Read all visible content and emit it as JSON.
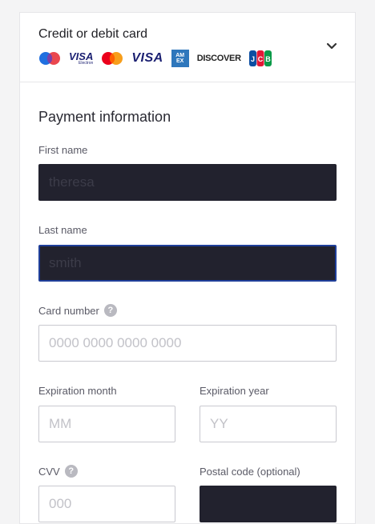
{
  "payment_method": {
    "title": "Credit or debit card",
    "logos": [
      "maestro",
      "visa-electron",
      "mastercard",
      "visa",
      "amex",
      "discover",
      "jcb"
    ],
    "logo_text": {
      "visa_electron": "VISA",
      "visa_electron_sub": "Electron",
      "visa": "VISA",
      "amex": "AM EX",
      "discover": "DISCOVER",
      "jcb": "JCB"
    }
  },
  "section": {
    "title": "Payment information"
  },
  "fields": {
    "first_name": {
      "label": "First name",
      "value": "theresa"
    },
    "last_name": {
      "label": "Last name",
      "value": "smith"
    },
    "card_number": {
      "label": "Card number",
      "placeholder": "0000 0000 0000 0000",
      "help": "?"
    },
    "exp_month": {
      "label": "Expiration month",
      "placeholder": "MM"
    },
    "exp_year": {
      "label": "Expiration year",
      "placeholder": "YY"
    },
    "cvv": {
      "label": "CVV",
      "placeholder": "000",
      "help": "?"
    },
    "postal": {
      "label": "Postal code (optional)",
      "value": ""
    }
  },
  "colors": {
    "dark_input": "#22222e",
    "focus": "#1f3f9a",
    "maestro_blue": "#1f6fe0",
    "mc_red": "#eb001b",
    "mc_orange": "#f79e1b",
    "visa_blue": "#1a1f71",
    "amex_blue": "#2e77bc",
    "jcb_green": "#0a9a48"
  }
}
